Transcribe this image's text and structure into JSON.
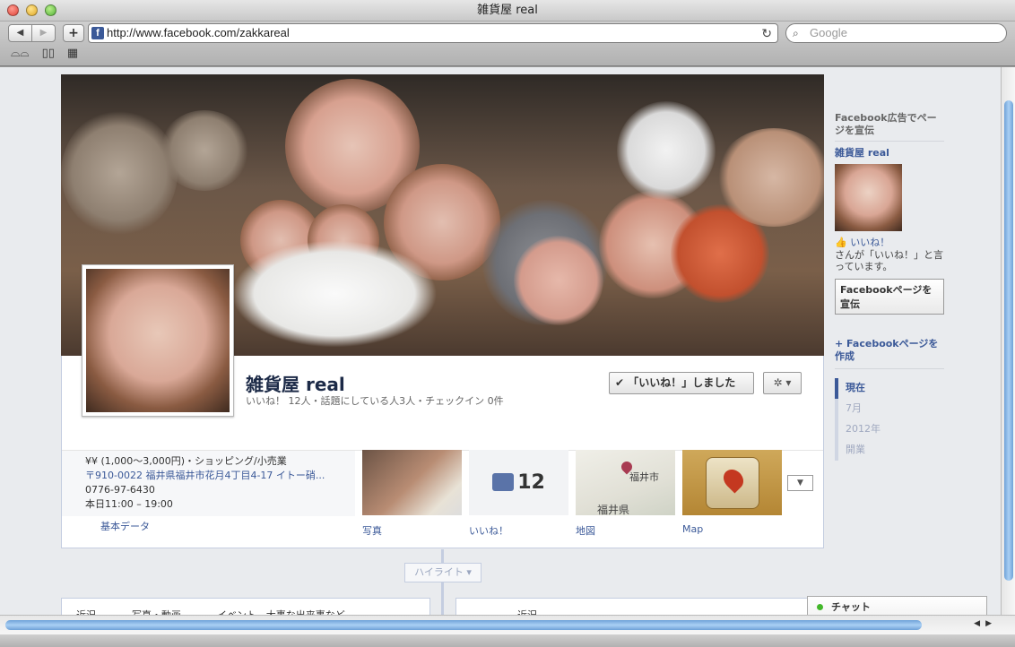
{
  "window": {
    "title": "雑貨屋 real"
  },
  "toolbar": {
    "back": "◀",
    "forward": "▶",
    "add": "+",
    "url": "http://www.facebook.com/zakkareal",
    "favicon": "f",
    "reload": "↻",
    "search_placeholder": "Google",
    "bookmarks": [
      "reader-glasses-icon",
      "book-icon",
      "grid-icon"
    ]
  },
  "profile": {
    "name": "雑貨屋 real",
    "stats": "いいね！ 12人・話題にしている人3人・チェックイン 0件",
    "like_button": "「いいね！」しました",
    "like_check": "✔",
    "gear": "✲ ▾"
  },
  "about": {
    "price": "¥¥ (1,000〜3,000円)・ショッピング/小売業",
    "address": "〒910-0022 福井県福井市花月4丁目4-17 イトー硝...",
    "phone": "0776-97-6430",
    "hours": "本日11:00 – 19:00",
    "label": "基本データ"
  },
  "apps": [
    {
      "label": "写真"
    },
    {
      "label": "いいね！",
      "count": "12"
    },
    {
      "label": "地図",
      "map_city": "福井市",
      "map_pref": "福井県"
    },
    {
      "label": "Map"
    }
  ],
  "timeline": {
    "highlight": "ハイライト ▾",
    "composer": [
      "近況",
      "写真・動画",
      "イベント、大事な出来事など"
    ],
    "composer_right": "近況"
  },
  "rail": {
    "ad_title": "Facebook広告でページを宣伝",
    "page_name": "雑貨屋 real",
    "like_link": "いいね！",
    "like_sub": "さんが「いいね！」と言っています。",
    "promote_button": "Facebookページを宣伝",
    "create_page": "+ Facebookページを作成",
    "scrubber": [
      "現在",
      "7月",
      "2012年",
      "開業"
    ]
  },
  "chat": {
    "label": "チャット"
  },
  "colors": {
    "facebook_blue": "#3b5998",
    "page_bg": "#e9ebee",
    "online": "#42b72a"
  }
}
